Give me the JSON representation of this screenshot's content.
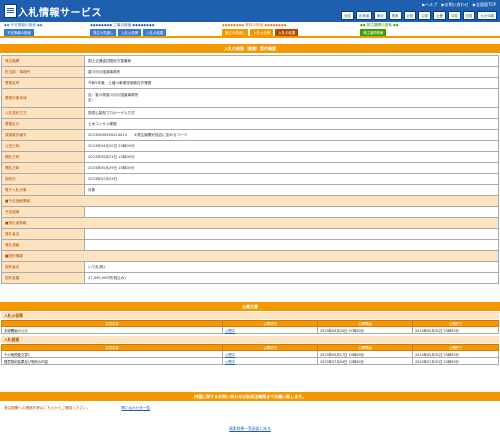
{
  "header": {
    "title": "入札情報サービス",
    "links": [
      "▶ヘルプ",
      "▶お問い合わせ",
      "▶全国版TOP"
    ],
    "regions": [
      "全国",
      "北海道",
      "東北",
      "関東",
      "北陸",
      "中部",
      "近畿",
      "中国",
      "四国",
      "九州沖縄"
    ]
  },
  "nav": {
    "group1": {
      "caption": "◆◆ 予定情報の検索 ◆◆",
      "buttons": [
        "予定情報の検索"
      ]
    },
    "group2": {
      "caption": "◆◆◆◆◆◆◆◆ 工事の検索 ◆◆◆◆◆◆◆◆",
      "buttons": [
        "発注の見通し",
        "入札公告等",
        "入札の結果"
      ]
    },
    "group3": {
      "caption": "◆◆◆◆◆◆◆◆ 業務の検索 ◆◆◆◆◆◆◆◆",
      "buttons": [
        "発注の見通し",
        "入札公告等",
        "入札の結果"
      ]
    },
    "group4": {
      "caption": "◆◆ 発注機関の検索 ◆◆",
      "buttons": [
        "発注機関情報"
      ]
    }
  },
  "section_title": "入札の経過（業務）案件概要",
  "rows": [
    {
      "label": "発注機関",
      "value": "国土交通省四国地方整備局"
    },
    {
      "label": "担当部・事務所",
      "value": "香川河川国道事務所"
    },
    {
      "label": "業務名称",
      "value": "令和5年度　土器川事業評価検討外業務"
    },
    {
      "label": "業務対象地域",
      "value": "自：香川県香川河川国道事務所",
      "value2": "至："
    },
    {
      "label": "入札契約方式",
      "value": "簡易公募型プロポーザル方式"
    },
    {
      "label": "業務区分",
      "value": "土木コンサル業務"
    },
    {
      "label": "調達案件番号",
      "value": "20230600650024014　　※発注機関が独自に定めるコード"
    },
    {
      "label": "公告日時",
      "value": "2023年04月20日 10時00分"
    },
    {
      "label": "開札日時",
      "value": "2023年05月23日 10時00分"
    },
    {
      "label": "開札日時",
      "value": "2023年05月29日 10時00分"
    },
    {
      "label": "契約日",
      "value": "2023年07月03日"
    },
    {
      "label": "電子入札対象",
      "value": "対象"
    },
    {
      "label": "■予定価格情報",
      "value": ""
    },
    {
      "label": "予定価格",
      "value": ""
    },
    {
      "label": "■落札者情報",
      "value": ""
    },
    {
      "label": "落札者名",
      "value": ""
    },
    {
      "label": "落札価格",
      "value": ""
    },
    {
      "label": "■契約情報",
      "value": ""
    },
    {
      "label": "契約者名",
      "value": "いであ(株)"
    },
    {
      "label": "契約金額",
      "value": "27,995,000円(税込み)"
    }
  ],
  "docs": {
    "title": "公開文書",
    "koukoku": {
      "heading": "入札公告等",
      "headers": [
        "文書名称",
        "公開状況",
        "公開開始",
        "公開終了"
      ],
      "rows": [
        {
          "name": "手続開始の公示",
          "link": "公開中",
          "start": "2023年04月20日 07時00分",
          "end": "2023年05月31日 23時59分"
        }
      ]
    },
    "keika": {
      "heading": "入札経過",
      "headers": [
        "文書名称",
        "公開状況",
        "公開開始",
        "公開終了"
      ],
      "rows": [
        {
          "name": "その他関連文書1",
          "link": "公開中",
          "start": "2023年05月17日 10時00分",
          "end": "2023年05月31日 23時59分"
        },
        {
          "name": "随意契約結果及び契約の内容",
          "link": "公開中",
          "start": "2023年07月04日 10時00分",
          "end": "2023年07月31日 23時59分"
        }
      ]
    }
  },
  "contact": {
    "bar": "内容に関するお問い合わせは各発注機関までお願い致します。",
    "text": "発注機関への連絡先等はこちらからご確認ください。",
    "link": "問い合わせ先一覧"
  },
  "back_link": "検索結果一覧画面に戻る"
}
